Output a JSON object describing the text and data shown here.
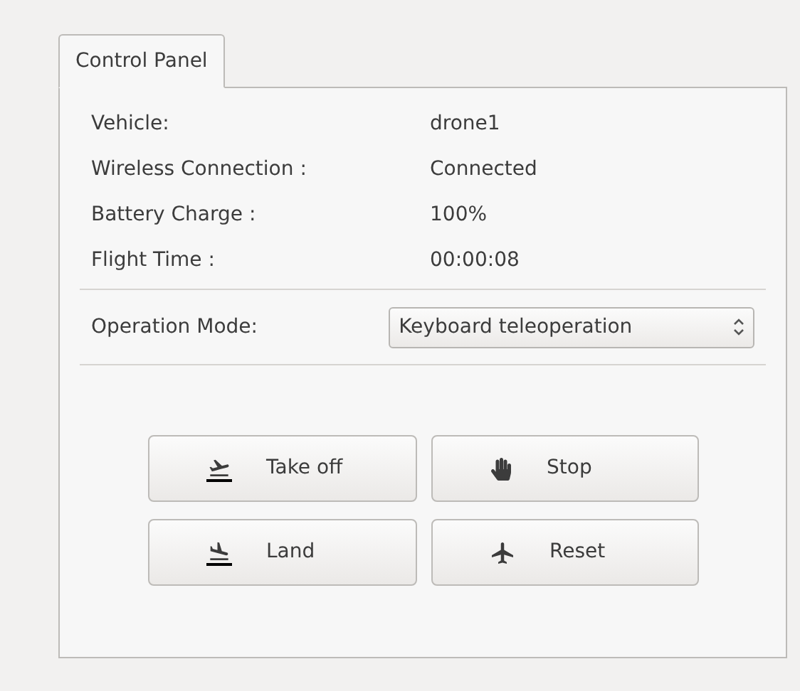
{
  "tabs": [
    {
      "label": "Control Panel",
      "selected": true
    }
  ],
  "info": [
    {
      "label": "Vehicle:",
      "value": "drone1"
    },
    {
      "label": "Wireless Connection :",
      "value": "Connected"
    },
    {
      "label": "Battery Charge :",
      "value": "100%"
    },
    {
      "label": "Flight Time :",
      "value": "00:00:08"
    }
  ],
  "operation_mode": {
    "label": "Operation Mode:",
    "value": "Keyboard teleoperation"
  },
  "buttons": [
    {
      "label": "Take off",
      "kind": "takeoff"
    },
    {
      "label": "Stop",
      "kind": "stop"
    },
    {
      "label": "Land",
      "kind": "land"
    },
    {
      "label": "Reset",
      "kind": "reset"
    }
  ]
}
